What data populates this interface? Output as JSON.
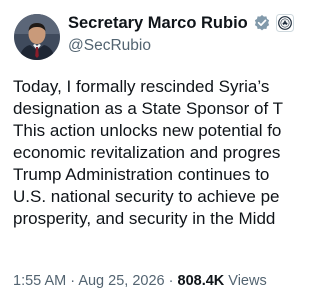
{
  "author": {
    "display_name": "Secretary Marco Rubio",
    "handle": "@SecRubio",
    "verified_badge_icon": "verified-gray-check-icon",
    "affiliate_badge_icon": "government-seal-icon",
    "badge_color": "#829aab"
  },
  "tweet": {
    "text": "Today, I formally rescinded Syria’s\ndesignation as a State Sponsor of T\nThis action unlocks new potential fo\neconomic revitalization and progres\nTrump Administration continues to \nU.S. national security to achieve pe\nprosperity, and security in the Midd"
  },
  "meta": {
    "time": "1:55 AM",
    "separator": "·",
    "date": "Aug 25, 2026",
    "views_count": "808.4K",
    "views_label": "Views"
  }
}
